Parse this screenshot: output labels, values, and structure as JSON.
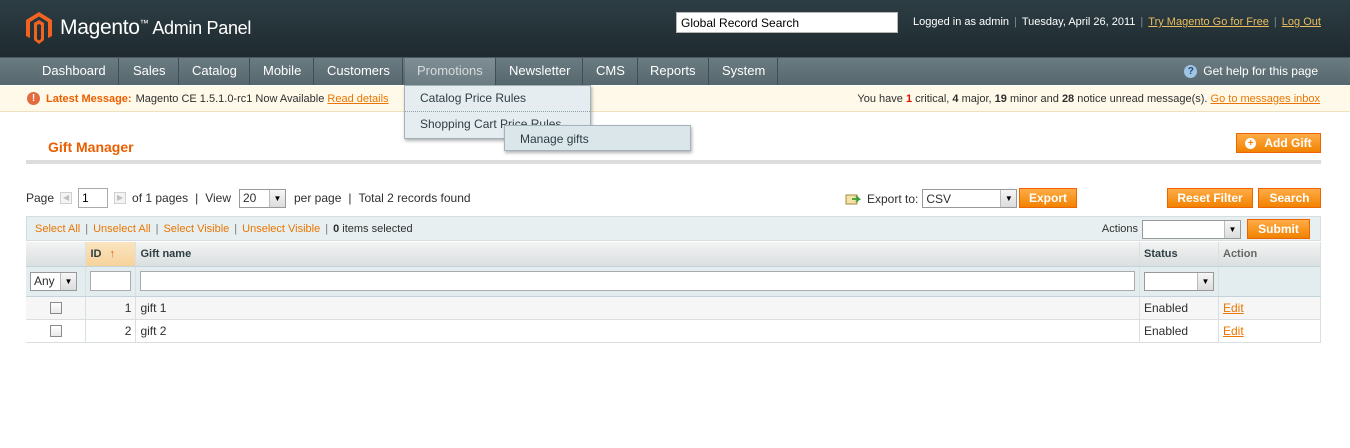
{
  "header": {
    "app_name": "Magento",
    "app_sub": "Admin Panel",
    "search_value": "Global Record Search",
    "logged_in": "Logged in as admin",
    "date": "Tuesday, April 26, 2011",
    "try_link": "Try Magento Go for Free",
    "logout_link": "Log Out"
  },
  "nav": {
    "items": [
      "Dashboard",
      "Sales",
      "Catalog",
      "Mobile",
      "Customers",
      "Promotions",
      "Newsletter",
      "CMS",
      "Reports",
      "System"
    ],
    "help": "Get help for this page",
    "promotions_menu": [
      "Catalog Price Rules",
      "Shopping Cart Price Rules"
    ],
    "submenu_item": "Manage gifts"
  },
  "message": {
    "label": "Latest Message:",
    "text": "Magento CE 1.5.1.0-rc1 Now Available",
    "link": "Read details",
    "summary_pre": "You have",
    "critical_count": "1",
    "critical_label": "critical,",
    "major_count": "4",
    "major_label": "major,",
    "minor_count": "19",
    "minor_label": "minor and",
    "notice_count": "28",
    "notice_label": "notice unread message(s).",
    "inbox_link": "Go to messages inbox"
  },
  "page": {
    "title": "Gift Manager",
    "add_button": "Add Gift"
  },
  "pager": {
    "page_label": "Page",
    "page_value": "1",
    "of_pages": "of 1 pages",
    "view_label": "View",
    "per_page_value": "20",
    "per_page_label": "per page",
    "total": "Total 2 records found",
    "export_label": "Export to:",
    "export_format": "CSV",
    "export_button": "Export",
    "reset_button": "Reset Filter",
    "search_button": "Search"
  },
  "massaction": {
    "select_all": "Select All",
    "unselect_all": "Unselect All",
    "select_visible": "Select Visible",
    "unselect_visible": "Unselect Visible",
    "selected_count": "0",
    "selected_label": "items selected",
    "actions_label": "Actions",
    "submit_button": "Submit"
  },
  "grid": {
    "columns": [
      "ID",
      "Gift name",
      "Status",
      "Action"
    ],
    "filter_any": "Any",
    "rows": [
      {
        "id": "1",
        "name": "gift 1",
        "status": "Enabled",
        "action": "Edit"
      },
      {
        "id": "2",
        "name": "gift 2",
        "status": "Enabled",
        "action": "Edit"
      }
    ]
  }
}
